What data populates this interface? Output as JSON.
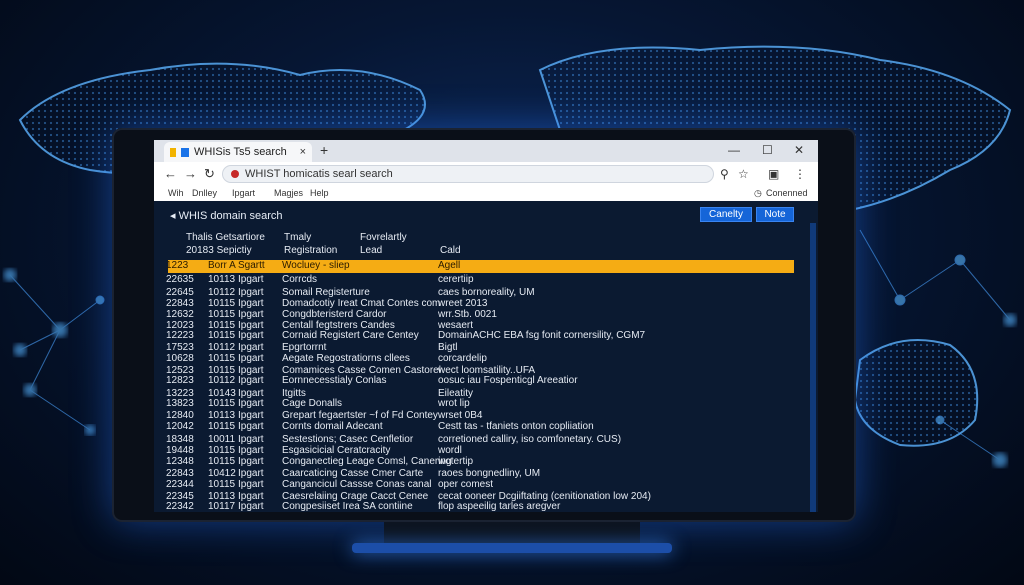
{
  "browser": {
    "tab_title": "WHISis Ts5 search",
    "tab_close": "×",
    "new_tab": "+",
    "url": "WHIST homicatis searl search",
    "bookmarks": [
      "Wih",
      "Dnlley",
      "Ipgart",
      "Magjes",
      "Help"
    ],
    "status_right": "Conenned"
  },
  "app": {
    "title": "WHIS domain search",
    "buttons": [
      "Canelty",
      "Note"
    ],
    "columns": {
      "c1": [
        "Thalis Getsartiore",
        "20183 Sepictiy"
      ],
      "c2": [
        "Tmaly",
        "Registration"
      ],
      "c3": [
        "Fovrelartly",
        "Lead"
      ],
      "c4": [
        "Cald"
      ]
    },
    "rows": [
      {
        "date": "1223",
        "time": "Borr A",
        "src": "Sgartt",
        "name": "Wocluey - sliep",
        "info": "Agell",
        "highlight": true
      },
      {
        "date": "22635",
        "time": "10113",
        "src": "Ipgart",
        "name": "Corrcds",
        "info": "cerertiip"
      },
      {
        "date": "22645",
        "time": "10112",
        "src": "Ipgart",
        "name": "Somail Registerture",
        "info": "caes bornoreality, UM"
      },
      {
        "date": "22843",
        "time": "10115",
        "src": "Ipgart",
        "name": "Domadcotiy Ireat Cmat Contes com",
        "info": "wreet 2013"
      },
      {
        "date": "12632",
        "time": "10115",
        "src": "Ipgart",
        "name": "Congdbteristerd Cardor",
        "info": "wrr.Stb. 0021"
      },
      {
        "date": "12023",
        "time": "10115",
        "src": "Ipgart",
        "name": "Centall fegtstrers Candes",
        "info": "wesaert"
      },
      {
        "date": "12223",
        "time": "10115",
        "src": "Ipgart",
        "name": "Cornaid Registert Care Centey",
        "info": "DomainACHC EBA fsg fonit cornersility, CGM7"
      },
      {
        "date": "17523",
        "time": "10112",
        "src": "Ipgart",
        "name": "Epgrtorrnt",
        "info": "Bigtl"
      },
      {
        "date": "10628",
        "time": "10115",
        "src": "Ipgart",
        "name": "Aegate Regostratiorns cllees",
        "info": "corcardelip"
      },
      {
        "date": "12523",
        "time": "10115",
        "src": "Ipgart",
        "name": "Comamices Casse Comen Castorel",
        "info": "wect loomsatility..UFA"
      },
      {
        "date": "12823",
        "time": "10112",
        "src": "Ipgart",
        "name": "Eornnecesstialy Conlas",
        "info": "oosuc iau Fospenticgl Areeatior"
      },
      {
        "date": "13223",
        "time": "10143",
        "src": "Ipgart",
        "name": "Itgitts",
        "info": "Eileatity"
      },
      {
        "date": "13823",
        "time": "10115",
        "src": "Ipgart",
        "name": "Cage Donalls",
        "info": "wrot lip"
      },
      {
        "date": "12840",
        "time": "10113",
        "src": "Ipgart",
        "name": "Grepart fegaertster ~f of Fd Contey",
        "info": "wrset 0B4"
      },
      {
        "date": "12042",
        "time": "10115",
        "src": "Ipgart",
        "name": "Cornts       domail Adecant",
        "info": "Cestt tas - tfaniets onton copliiation"
      },
      {
        "date": "18348",
        "time": "10011",
        "src": "Ipgart",
        "name": "Sestestions; Casec Cenfletior",
        "info": "corretioned calliry, iso comfonetary. CUS)"
      },
      {
        "date": "19448",
        "time": "10115",
        "src": "Ipgart",
        "name": "Esgasicicial Ceratcracity",
        "info": "wordl"
      },
      {
        "date": "12348",
        "time": "10115",
        "src": "Ipgart",
        "name": "Conganectieg Leage Comsl, Canering",
        "info": "wotertip"
      },
      {
        "date": "22843",
        "time": "10412",
        "src": "Ipgart",
        "name": "Caarcaticing Casse Cmer Carte",
        "info": "raoes bongnedliny, UM"
      },
      {
        "date": "22344",
        "time": "10115",
        "src": "Ipgart",
        "name": "Cangancicul Cassse Conas canal",
        "info": "oper comest"
      },
      {
        "date": "22345",
        "time": "10113",
        "src": "Ipgart",
        "name": "Caesrelaiing Crage Cacct Cenee",
        "info": "cecat ooneer Dcgiiftating (cenitionation low 204)"
      },
      {
        "date": "22342",
        "time": "10117",
        "src": "Ipgart",
        "name": "Congpesiiset Irea SA contiine",
        "info": "flop aspeeilig tarles aregver"
      }
    ]
  },
  "colors": {
    "accent": "#1565d8",
    "highlight_row": "#f5ac14",
    "screen_bg": "#0b1a31",
    "glow": "#3a8cff"
  },
  "icons": [
    "favicon-icon",
    "close-icon",
    "plus-icon",
    "back-arrow-icon",
    "forward-arrow-icon",
    "reload-icon",
    "lock-icon",
    "extension-icon",
    "star-icon",
    "profile-icon",
    "menu-icon",
    "minimize-icon",
    "maximize-icon",
    "window-close-icon",
    "clock-icon",
    "chevron-left-icon"
  ]
}
